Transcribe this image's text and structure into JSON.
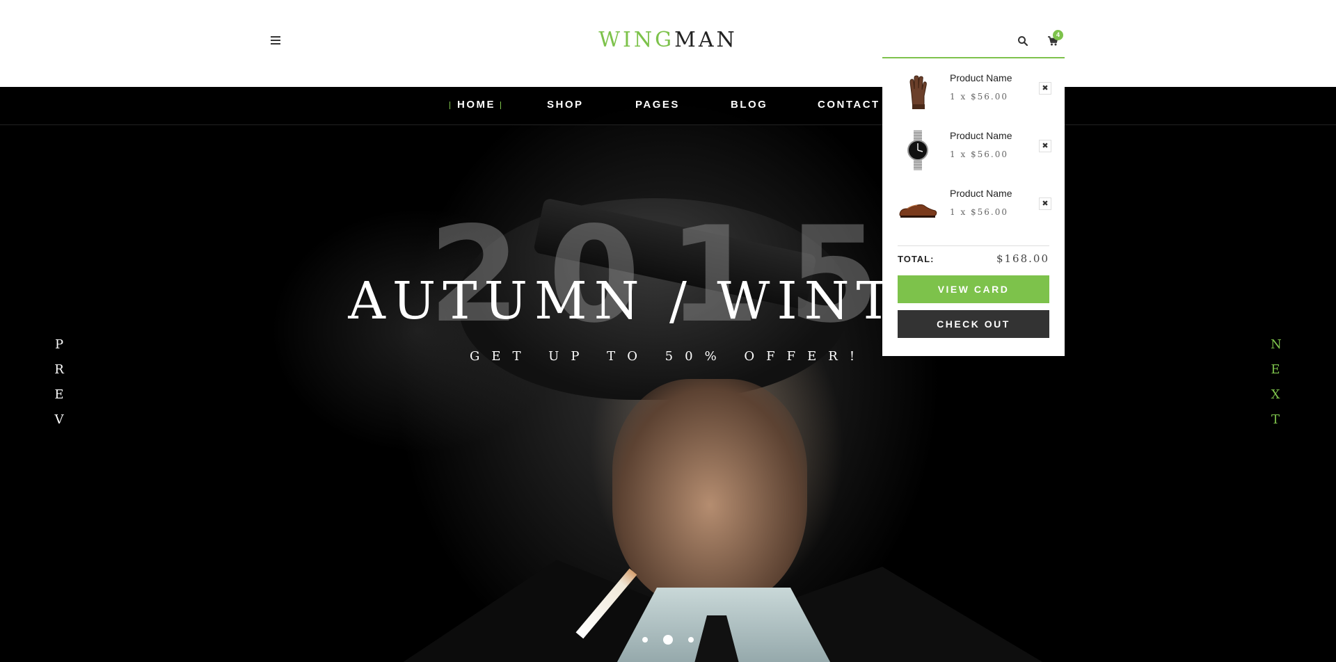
{
  "header": {
    "logo_accent": "WING",
    "logo_main": "MAN",
    "cart_count": "4",
    "accent_color": "#7dc24b"
  },
  "nav": {
    "items": [
      {
        "label": "HOME",
        "active": true
      },
      {
        "label": "SHOP"
      },
      {
        "label": "PAGES"
      },
      {
        "label": "BLOG"
      },
      {
        "label": "CONTACT"
      }
    ]
  },
  "hero": {
    "year": "2015",
    "headline": "AUTUMN / WINTER",
    "subline": "GET UP TO 50% OFFER!",
    "prev": [
      "P",
      "R",
      "E",
      "V"
    ],
    "next": [
      "N",
      "E",
      "X",
      "T"
    ],
    "slide_dots": 3,
    "active_slide": 2
  },
  "cart": {
    "items": [
      {
        "name": "Product Name",
        "price": "1 x $56.00",
        "icon": "glove-icon"
      },
      {
        "name": "Product Name",
        "price": "1 x $56.00",
        "icon": "watch-icon"
      },
      {
        "name": "Product Name",
        "price": "1 x $56.00",
        "icon": "shoe-icon"
      }
    ],
    "total_label": "TOTAL:",
    "total_value": "$168.00",
    "view_label": "VIEW CARD",
    "checkout_label": "CHECK OUT",
    "remove_glyph": "✖"
  }
}
